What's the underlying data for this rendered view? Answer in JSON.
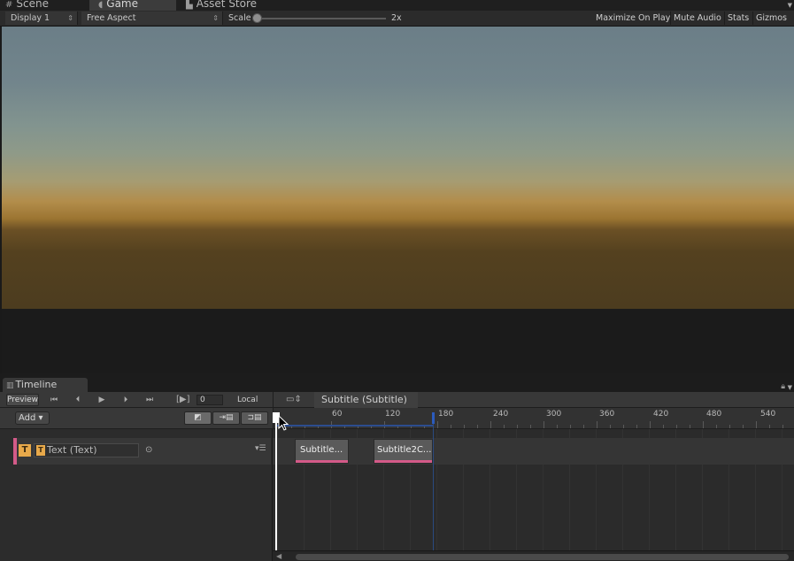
{
  "tabs": {
    "scene": "Scene",
    "game": "Game",
    "asset_store": "Asset Store"
  },
  "game_toolbar": {
    "display": "Display 1",
    "aspect": "Free Aspect",
    "scale_label": "Scale",
    "scale_value": "2x",
    "maximize_on_play": "Maximize On Play",
    "mute_audio": "Mute Audio",
    "stats": "Stats",
    "gizmos": "Gizmos"
  },
  "timeline": {
    "window_title": "Timeline",
    "preview_label": "Preview",
    "frame_value": "0",
    "time_mode": "Local",
    "breadcrumb": "Subtitle (Subtitle)",
    "add_label": "Add",
    "ruler_labels": [
      "60",
      "120",
      "180",
      "240",
      "300",
      "360",
      "420",
      "480",
      "540"
    ],
    "track": {
      "type_icon": "T",
      "binding_icon": "T",
      "binding": "Text (Text)"
    },
    "clips": [
      {
        "label": "Subtitle..."
      },
      {
        "label": "Subtitle2C..."
      }
    ]
  },
  "colors": {
    "track_accent": "#d35a88",
    "text_icon": "#e8a94a",
    "end_marker": "#2b5bbd"
  }
}
